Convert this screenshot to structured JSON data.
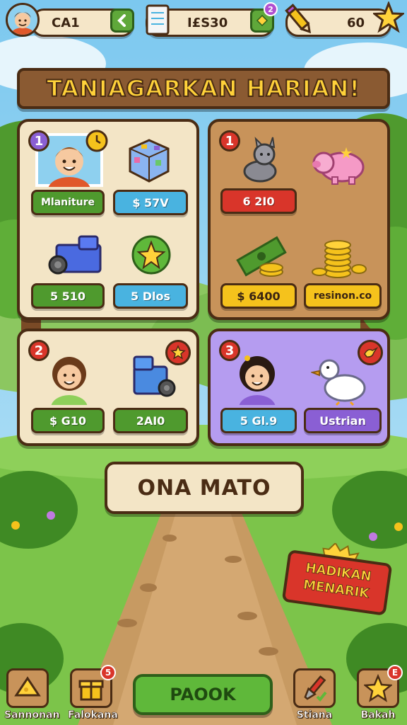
{
  "hud": {
    "player_name": "CA1",
    "currency_value": "I£S30",
    "currency_badge": "2",
    "energy_value": "60"
  },
  "banner": {
    "title": "TANIAGARKAN HARIAN!"
  },
  "panels": [
    {
      "badge": "1",
      "items": [
        {
          "label": "Mlaniture"
        },
        {
          "label": "$ 57V"
        },
        {
          "label": "5 510"
        },
        {
          "label": "5 Dlos"
        }
      ]
    },
    {
      "badge": "1",
      "items": [
        {
          "label": "6 2I0"
        },
        {
          "label": "$ 6400"
        },
        {
          "label": "resinon.co"
        }
      ]
    },
    {
      "badge": "2",
      "items": [
        {
          "label": "$ G10"
        },
        {
          "label": "2AI0"
        }
      ]
    },
    {
      "badge": "3",
      "items": [
        {
          "label": "5 Gl.9"
        },
        {
          "label": "Ustrian"
        }
      ]
    }
  ],
  "center_button": {
    "label": "ONA MATO"
  },
  "promo": {
    "line1": "HADIKAN",
    "line2": "MENARIK"
  },
  "bottom_nav": {
    "items": [
      {
        "label": "Sannonan",
        "badge": ""
      },
      {
        "label": "Falokana",
        "badge": "5"
      },
      {
        "label": "Stiana",
        "badge": ""
      },
      {
        "label": "Bakah",
        "badge": "E"
      }
    ],
    "main_label": "PAOOK"
  },
  "colors": {
    "wood": "#8a5a32",
    "outline": "#4a2c14",
    "gold": "#ffd23a",
    "green": "#5fb83a",
    "red": "#d9352a",
    "purple": "#b59cf0"
  }
}
